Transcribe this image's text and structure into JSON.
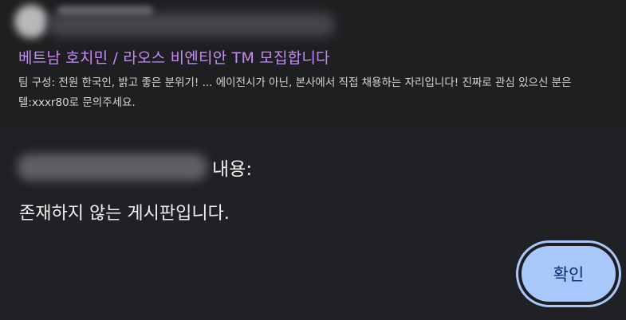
{
  "search_result": {
    "title": "베트남 호치민 / 라오스 비엔티안 TM 모집합니다",
    "snippet": "팀 구성: 전원 한국인, 밝고 좋은 분위기! ... 에이전시가 아닌, 본사에서 직접 채용하는 자리입니다! 진짜로 관심 있으신 분은 텔:xxxr80로 문의주세요.",
    "title_color": "#c58af9"
  },
  "dialog": {
    "heading_suffix": "내용:",
    "message": "존재하지 않는 게시판입니다.",
    "ok_label": "확인",
    "accent_color": "#a8c7fa"
  }
}
